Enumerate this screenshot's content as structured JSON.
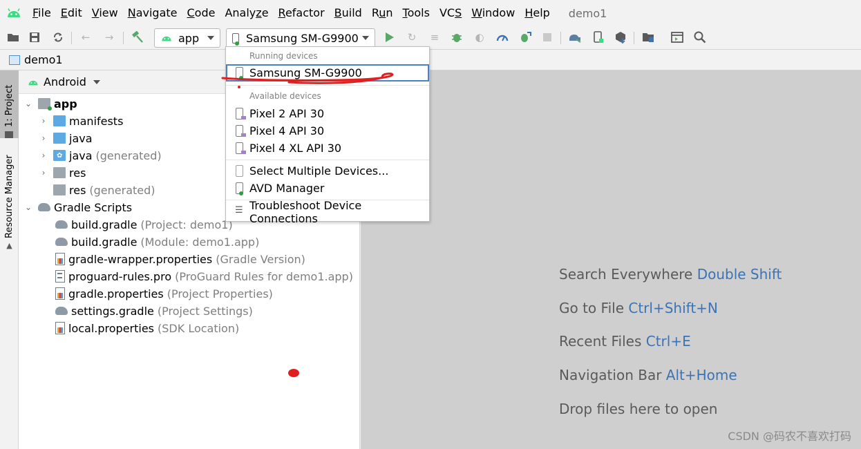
{
  "menubar": {
    "items": [
      "File",
      "Edit",
      "View",
      "Navigate",
      "Code",
      "Analyze",
      "Refactor",
      "Build",
      "Run",
      "Tools",
      "VCS",
      "Window",
      "Help"
    ],
    "underline": [
      "F",
      "E",
      "V",
      "N",
      "C",
      "z",
      "R",
      "B",
      "u",
      "T",
      "S",
      "W",
      "H"
    ],
    "project_name": "demo1"
  },
  "toolbar": {
    "run_config": "app",
    "device": "Samsung SM-G9900"
  },
  "navbar": {
    "breadcrumb": "demo1"
  },
  "stripe": {
    "project_tab": "1: Project",
    "resource_tab": "Resource Manager"
  },
  "project_panel": {
    "view_mode": "Android",
    "tree": [
      {
        "label": "app",
        "hint": "",
        "icon": "module-folder-icon",
        "bold": true
      },
      {
        "label": "manifests",
        "hint": "",
        "icon": "folder-icon"
      },
      {
        "label": "java",
        "hint": "",
        "icon": "folder-icon"
      },
      {
        "label": "java",
        "hint": "(generated)",
        "icon": "generated-folder-icon"
      },
      {
        "label": "res",
        "hint": "",
        "icon": "res-folder-icon"
      },
      {
        "label": "res",
        "hint": "(generated)",
        "icon": "res-folder-icon"
      },
      {
        "label": "Gradle Scripts",
        "hint": "",
        "icon": "gradle-icon"
      },
      {
        "label": "build.gradle",
        "hint": "(Project: demo1)",
        "icon": "gradle-icon"
      },
      {
        "label": "build.gradle",
        "hint": "(Module: demo1.app)",
        "icon": "gradle-icon"
      },
      {
        "label": "gradle-wrapper.properties",
        "hint": "(Gradle Version)",
        "icon": "properties-icon"
      },
      {
        "label": "proguard-rules.pro",
        "hint": "(ProGuard Rules for demo1.app)",
        "icon": "text-file-icon"
      },
      {
        "label": "gradle.properties",
        "hint": "(Project Properties)",
        "icon": "properties-icon"
      },
      {
        "label": "settings.gradle",
        "hint": "(Project Settings)",
        "icon": "gradle-icon"
      },
      {
        "label": "local.properties",
        "hint": "(SDK Location)",
        "icon": "properties-icon"
      }
    ]
  },
  "device_dropdown": {
    "running_header": "Running devices",
    "running": [
      "Samsung SM-G9900"
    ],
    "available_header": "Available devices",
    "available": [
      "Pixel 2 API 30",
      "Pixel 4 API 30",
      "Pixel 4 XL API 30"
    ],
    "select_multiple": "Select Multiple Devices...",
    "avd_manager": "AVD Manager",
    "troubleshoot": "Troubleshoot Device Connections"
  },
  "editor_hints": [
    {
      "text": "Search Everywhere",
      "key": "Double Shift"
    },
    {
      "text": "Go to File",
      "key": "Ctrl+Shift+N"
    },
    {
      "text": "Recent Files",
      "key": "Ctrl+E"
    },
    {
      "text": "Navigation Bar",
      "key": "Alt+Home"
    },
    {
      "text": "Drop files here to open",
      "key": ""
    }
  ],
  "watermark": "CSDN @码农不喜欢打码",
  "colors": {
    "android_green": "#3ddc84",
    "run_green": "#59a869",
    "link_blue": "#3c73b5",
    "annotation_red": "#e02020"
  }
}
